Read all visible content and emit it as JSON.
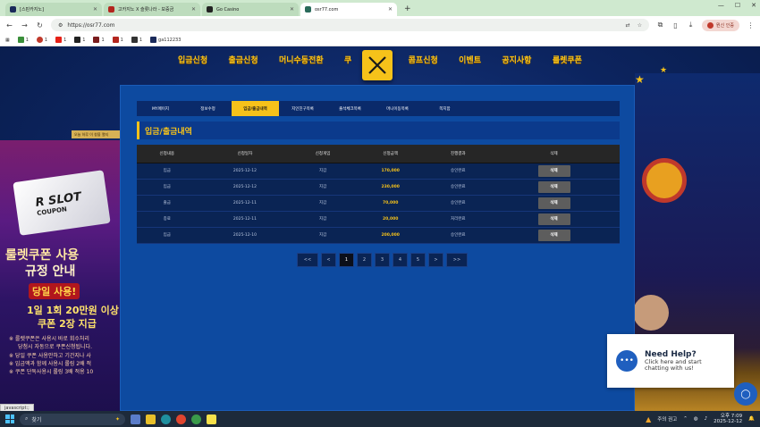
{
  "browser": {
    "tabs": [
      {
        "title": "[스핀카지노]",
        "active": false
      },
      {
        "title": "고카지노 X 슬롯나라 - 보증금",
        "active": false
      },
      {
        "title": "Go Casino",
        "active": false
      },
      {
        "title": "osr77.com",
        "active": true
      }
    ],
    "url": "https://osr77.com",
    "profile_label": "뭔신 인증",
    "bookmarks": [
      "1",
      "1",
      "1",
      "1",
      "1",
      "1",
      "1",
      "ga112233"
    ]
  },
  "site": {
    "nav": [
      "입금신청",
      "출금신청",
      "머니수동전환",
      "쿠",
      "콤프신청",
      "이벤트",
      "공지사항",
      "룰렛쿠폰"
    ],
    "subtabs": [
      "MY페이지",
      "정보수정",
      "입금/출금내역",
      "지인친구목록",
      "출석체크목록",
      "머니이동목록",
      "쪽지함"
    ],
    "active_subtab": 2,
    "section_title": "입금/출금내역",
    "table": {
      "headers": [
        "신청내용",
        "신청일자",
        "신청게임",
        "신청금액",
        "진행결과",
        "삭제"
      ],
      "rows": [
        {
          "type": "입금",
          "date": "2025-12-12",
          "game": "지갑",
          "amount": "170,000",
          "result": "승인완료",
          "action": "삭제"
        },
        {
          "type": "입금",
          "date": "2025-12-12",
          "game": "지갑",
          "amount": "230,000",
          "result": "승인완료",
          "action": "삭제"
        },
        {
          "type": "출금",
          "date": "2025-12-11",
          "game": "지갑",
          "amount": "70,000",
          "result": "승인완료",
          "action": "삭제"
        },
        {
          "type": "종료",
          "date": "2025-12-11",
          "game": "지갑",
          "amount": "20,000",
          "result": "처리완료",
          "action": "삭제"
        },
        {
          "type": "입금",
          "date": "2025-12-10",
          "game": "지갑",
          "amount": "200,000",
          "result": "승인완료",
          "action": "삭제"
        }
      ]
    },
    "pagination": [
      "<<",
      "<",
      "1",
      "2",
      "3",
      "4",
      "5",
      ">",
      ">>"
    ],
    "current_page": "1"
  },
  "promo": {
    "tag": "오늘 하루 이 창을 열지",
    "coupon_big": "R SLOT",
    "coupon_small": "COUPON",
    "line1": "룰렛쿠폰 사용",
    "line2": "규정 안내",
    "line3": "당일 사용!",
    "line4": "1일 1회 20만원 이상",
    "line5": "쿠폰 2장 지급",
    "notes": [
      "※ 룰렛쿠폰은 사용시 바로 회수처리",
      "당첨시 자동으로 쿠폰신청됩니다.",
      "※ 당일 쿠폰 사용안하고 기간지나 사",
      "※ 입금액과 함께 사용시 롤링 2배 적",
      "※ 쿠폰 단독사용시 롤링 3배 적용 10"
    ]
  },
  "chat": {
    "title": "Need Help?",
    "subtitle": "Click here and start chatting with us!"
  },
  "status_hint": "javascript:;",
  "taskbar": {
    "search_placeholder": "찾기",
    "weather": "주의 권고",
    "time": "오후 7:09",
    "date": "2025-12-12"
  },
  "colors": {
    "accent": "#f6c21a",
    "panel": "#0d4aa0",
    "delete_button": "#5d5d5d"
  }
}
